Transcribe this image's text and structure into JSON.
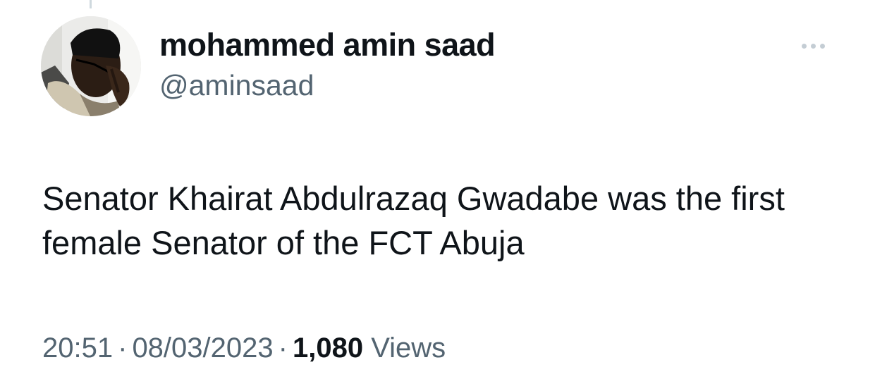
{
  "author": {
    "display_name": "mohammed amin saad",
    "handle": "@aminsaad"
  },
  "icons": {
    "avatar": "avatar-photo",
    "more": "more-horizontal-icon"
  },
  "tweet": {
    "text": "Senator Khairat Abdulrazaq Gwadabe was the first female Senator of the FCT Abuja"
  },
  "meta": {
    "time": "20:51",
    "separator": "·",
    "date": "08/03/2023",
    "views_count": "1,080",
    "views_label": "Views"
  },
  "colors": {
    "text_primary": "#0f1419",
    "text_secondary": "#536471",
    "more_dots": "#c4cdd4"
  }
}
